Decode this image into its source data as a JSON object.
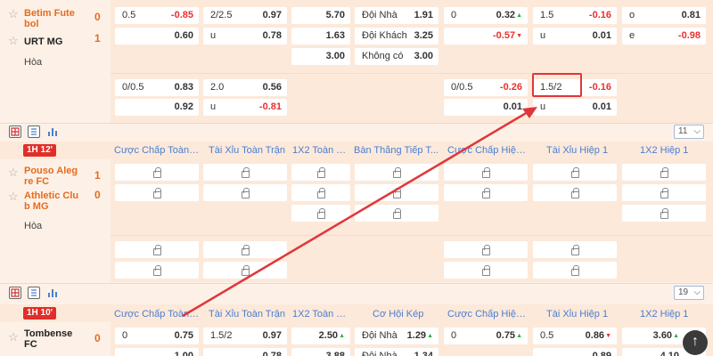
{
  "match1": {
    "home": "Betim Fute bol",
    "away": "URT MG",
    "draw": "Hòa",
    "home_score": "0",
    "away_score": "1",
    "row1": {
      "hdp": "0.5",
      "hdp_odds": "-0.85",
      "ou": "2/2.5",
      "ou_odds": "0.97",
      "x12": "5.70",
      "dc_label": "Đội Nhà",
      "dc": "1.91",
      "h1_hdp": "0",
      "h1_hdp_odds": "0.32",
      "h1_ou": "1.5",
      "h1_ou_odds": "-0.16",
      "h1_x_label": "o",
      "h1_x": "0.81"
    },
    "row2": {
      "hdp_odds": "0.60",
      "ou_label": "u",
      "ou_odds": "0.78",
      "x12": "1.63",
      "dc_label": "Đội Khách",
      "dc": "3.25",
      "h1_hdp_odds": "-0.57",
      "h1_ou_label": "u",
      "h1_ou_odds": "0.01",
      "h1_x_label": "e",
      "h1_x": "-0.98"
    },
    "row3": {
      "x12": "3.00",
      "dc_label": "Không có",
      "dc": "3.00"
    },
    "row4": {
      "hdp": "0/0.5",
      "hdp_odds": "0.83",
      "ou": "2.0",
      "ou_odds": "0.56",
      "h1_hdp": "0/0.5",
      "h1_hdp_odds": "-0.26",
      "h1_ou": "1.5/2",
      "h1_ou_odds": "-0.16"
    },
    "row5": {
      "hdp_odds": "0.92",
      "ou_label": "u",
      "ou_odds": "-0.81",
      "h1_hdp_odds": "0.01",
      "h1_ou_label": "u",
      "h1_ou_odds": "0.01"
    }
  },
  "toolbar1": {
    "count": "11"
  },
  "match2": {
    "live_badge": "1H 12'",
    "headers": [
      "Cược Chấp Toàn T...",
      "Tài Xỉu Toàn Trận",
      "1X2 Toàn Tr...",
      "Bàn Thắng Tiếp T...",
      "Cược Chấp Hiệp 1",
      "Tài Xỉu Hiệp 1",
      "1X2 Hiệp 1"
    ],
    "home": "Pouso Aleg re FC",
    "away": "Athletic Clu b MG",
    "draw": "Hòa",
    "home_score": "1",
    "away_score": "0"
  },
  "toolbar2": {
    "count": "19"
  },
  "match3": {
    "live_badge": "1H 10'",
    "headers": [
      "Cược Chấp Toàn T...",
      "Tài Xỉu Toàn Trận",
      "1X2 Toàn Tr...",
      "Cơ Hội Kép",
      "Cược Chấp Hiệp 1",
      "Tài Xỉu Hiệp 1",
      "1X2 Hiệp 1"
    ],
    "home": "Tombense FC",
    "home_score": "0",
    "row1": {
      "hdp": "0",
      "hdp_odds": "0.75",
      "ou": "1.5/2",
      "ou_odds": "0.97",
      "x12": "2.50",
      "dc_label": "Đội Nhà",
      "dc": "1.29",
      "h1_hdp": "0",
      "h1_hdp_odds": "0.75",
      "h1_ou": "0.5",
      "h1_ou_odds": "0.86",
      "h1_x": "3.60"
    },
    "row2": {
      "hdp_odds": "1.00",
      "ou_odds": "0.78",
      "x12": "3.88",
      "dc_label": "Đội Nhà",
      "dc": "1.34",
      "h1_ou_odds": "0.89",
      "h1_x": "4.10"
    }
  },
  "colors": {
    "accent": "#e56b1f",
    "negative": "#e8322e",
    "header_link": "#4a7ed0",
    "live": "#e02e2a",
    "highlight": "#e0363b"
  }
}
